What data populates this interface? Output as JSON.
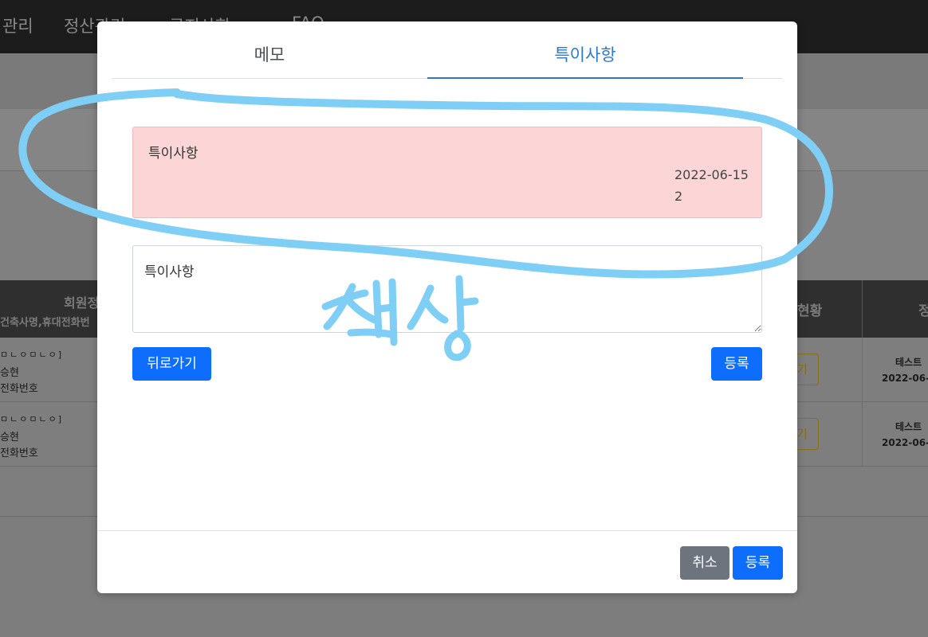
{
  "background": {
    "nav_items": [
      "관리",
      "정산관리",
      "공지사항",
      "FAQ"
    ],
    "table": {
      "header_member": "회원정",
      "header_member_sub": "건축사명,휴대전화번",
      "header_status": "현황",
      "header_last": "정",
      "rows": [
        {
          "name_line1": "ㅁㄴㅇㅁㄴㅇ]",
          "name_line2": "승현",
          "name_line3": "전화번호",
          "button": "기",
          "right_line1": "테스트",
          "right_line2": "2022-06-"
        },
        {
          "name_line1": "ㅁㄴㅇㅁㄴㅇ]",
          "name_line2": "승현",
          "name_line3": "전화번호",
          "button": "기",
          "right_line1": "테스트",
          "right_line2": "2022-06-"
        }
      ]
    }
  },
  "modal": {
    "tabs": [
      {
        "label": "메모",
        "active": false
      },
      {
        "label": "특이사항",
        "active": true
      }
    ],
    "note": {
      "title": "특이사항",
      "date": "2022-06-152"
    },
    "textarea": {
      "value": "특이사항"
    },
    "back_button": "뒤로가기",
    "register_button": "등록",
    "footer": {
      "cancel_button": "취소",
      "register_button": "등록"
    }
  },
  "annotation": {
    "text": "정상",
    "color": "#7fcef5"
  },
  "colors": {
    "accent": "#2a7bd0",
    "primary": "#0d6efd",
    "secondary": "#6c757d",
    "note_bg": "#fcd6d6"
  }
}
